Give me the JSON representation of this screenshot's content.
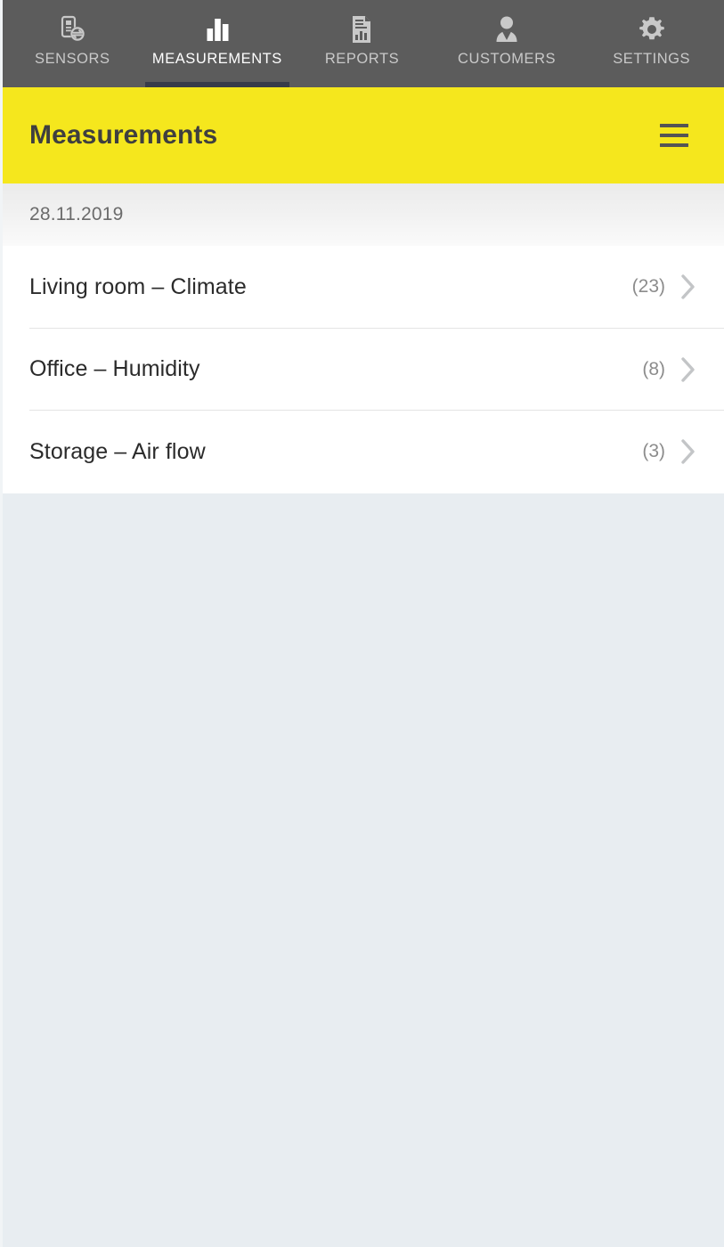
{
  "topnav": {
    "background": "#5c5c5c",
    "active_underline_color": "#383c49",
    "tabs": [
      {
        "label": "SENSORS",
        "icon": "sensor-sync-icon",
        "active": false
      },
      {
        "label": "MEASUREMENTS",
        "icon": "bar-chart-icon",
        "active": true
      },
      {
        "label": "REPORTS",
        "icon": "report-doc-icon",
        "active": false
      },
      {
        "label": "CUSTOMERS",
        "icon": "person-icon",
        "active": false
      },
      {
        "label": "SETTINGS",
        "icon": "gear-icon",
        "active": false
      }
    ]
  },
  "header": {
    "title": "Measurements",
    "background": "#f5e71d",
    "title_color": "#3f3f3f",
    "menu_icon": "hamburger-menu-icon"
  },
  "date_section": {
    "label": "28.11.2019"
  },
  "list": {
    "rows": [
      {
        "title": "Living room – Climate",
        "count": "(23)",
        "chevron": "chevron-right-icon"
      },
      {
        "title": "Office – Humidity",
        "count": "(8)",
        "chevron": "chevron-right-icon"
      },
      {
        "title": "Storage – Air flow",
        "count": "(3)",
        "chevron": "chevron-right-icon"
      }
    ]
  },
  "page": {
    "background": "#e8edf1"
  }
}
